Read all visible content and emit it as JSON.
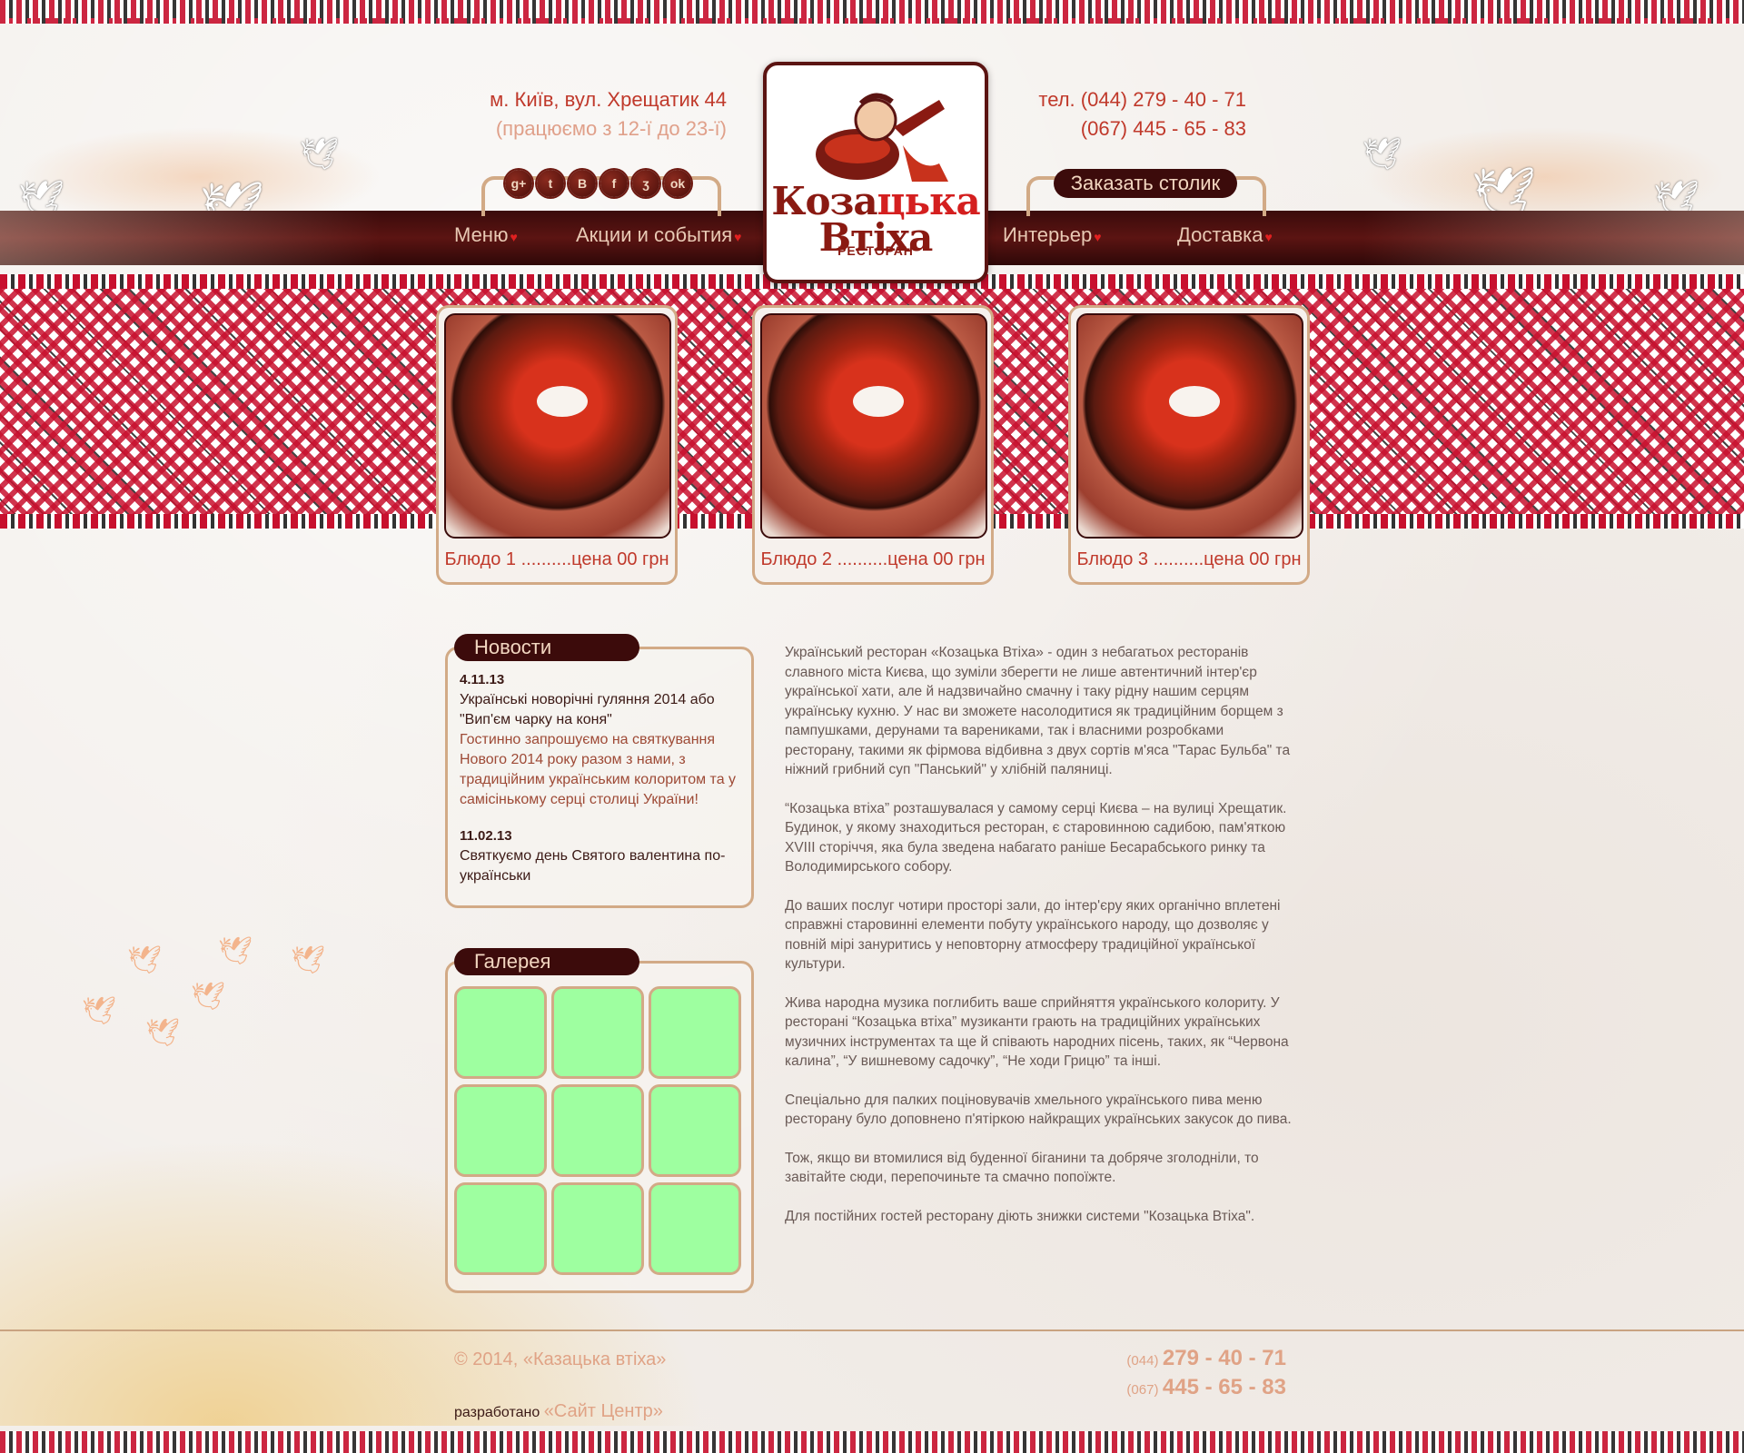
{
  "header": {
    "address": "м. Київ, вул. Хрещатик 44",
    "hours": "(працюємо з 12-ї до 23-ї)",
    "phone_1": "тел. (044) 279 - 40 - 71",
    "phone_2": "(067) 445 - 65 - 83",
    "reserve_button": "Заказать столик",
    "social_icons": [
      {
        "name": "google-plus-icon",
        "glyph": "g+"
      },
      {
        "name": "twitter-icon",
        "glyph": "t"
      },
      {
        "name": "vk-icon",
        "glyph": "B"
      },
      {
        "name": "facebook-icon",
        "glyph": "f"
      },
      {
        "name": "rss-icon",
        "glyph": "ʒ"
      },
      {
        "name": "odnoklassniki-icon",
        "glyph": "ok"
      }
    ]
  },
  "logo": {
    "line1_a": "Коза",
    "line1_b": "цька",
    "line2": "Втіха",
    "subtitle": "РЕСТОРАН"
  },
  "nav": {
    "items": [
      {
        "label": "Меню"
      },
      {
        "label": "Акции и события"
      },
      {
        "label": "Интерьер"
      },
      {
        "label": "Доставка"
      }
    ],
    "heart_glyph": "♥"
  },
  "dishes": [
    {
      "caption": "Блюдо 1 ..........цена 00 грн"
    },
    {
      "caption": "Блюдо 2 ..........цена 00 грн"
    },
    {
      "caption": "Блюдо 3 ..........цена 00 грн"
    }
  ],
  "news": {
    "heading": "Новости",
    "items": [
      {
        "date": "4.11.13",
        "title": "Українські новорічні гуляння 2014 або \"Вип'єм чарку на коня\"",
        "body": "Гостинно запрошуємо на святкування Нового 2014 року разом з нами, з традиційним українським колоритом та у самісінькому серці столиці України!"
      },
      {
        "date": "11.02.13",
        "title": "Святкуємо день Святого валентина по-українськи",
        "body": ""
      }
    ]
  },
  "gallery": {
    "heading": "Галерея",
    "thumb_color": "#9effa0"
  },
  "article": {
    "paragraphs": [
      "Український ресторан «Козацька Втіха» - один з небагатьох ресторанів славного міста Києва, що зуміли зберегти не лише автентичний інтер'єр української хати, але й надзвичайно смачну і таку рідну нашим серцям українську кухню. У нас ви зможете насолодитися як традиційним борщем з пампушками, дерунами та варениками, так і власними розробками ресторану, такими як фірмова відбивна з двух сортів м'яса \"Тарас Бульба\" та ніжний грибний суп \"Панський\" у хлібній паляниці.",
      "“Козацька втіха” розташувалася у самому серці Києва – на вулиці Хрещатик. Будинок, у якому знаходиться ресторан, є старовинною садибою, пам'яткою XVIII сторіччя, яка була зведена набагато раніше Бесарабського ринку та Володимирського собору.",
      "До ваших послуг чотири просторі зали, до інтер'єру яких органічно вплетені  справжні старовинні  елементи  побуту українського народу, що дозволяє у повній мірі зануритись у неповторну атмосферу традиційної української культури.",
      "Жива народна музика поглибить ваше сприйняття українського колориту. У ресторані “Козацька втіха” музиканти грають на традиційних українських музичних інструментах та ще й співають народних пісень, таких, як “Червона калина”, “У вишневому садочку”, “Не ходи Грицю” та інші.",
      "Спеціально для палких поціновувачів хмельного українського пива меню ресторану було доповнено п'ятіркою найкращих українських закусок до пива.",
      "Тож, якщо ви втомилися від буденної біганини та добряче зголодніли, то завітайте сюди, перепочиньте та смачно попоїжте.",
      "Для постійних гостей ресторану діють знижки системи \"Козацька Втіха\"."
    ]
  },
  "footer": {
    "copyright": "© 2014, «Казацька втіха»",
    "developed_label": "разработано ",
    "developed_link": "«Сайт Центр»",
    "phone_1_code": "(044)",
    "phone_1_number": "279 - 40 - 71",
    "phone_2_code": "(067)",
    "phone_2_number": "445 - 65 - 83"
  },
  "colors": {
    "brand_dark": "#3c0b0b",
    "accent_red": "#c0392b",
    "border_tan": "#d2aa86"
  }
}
